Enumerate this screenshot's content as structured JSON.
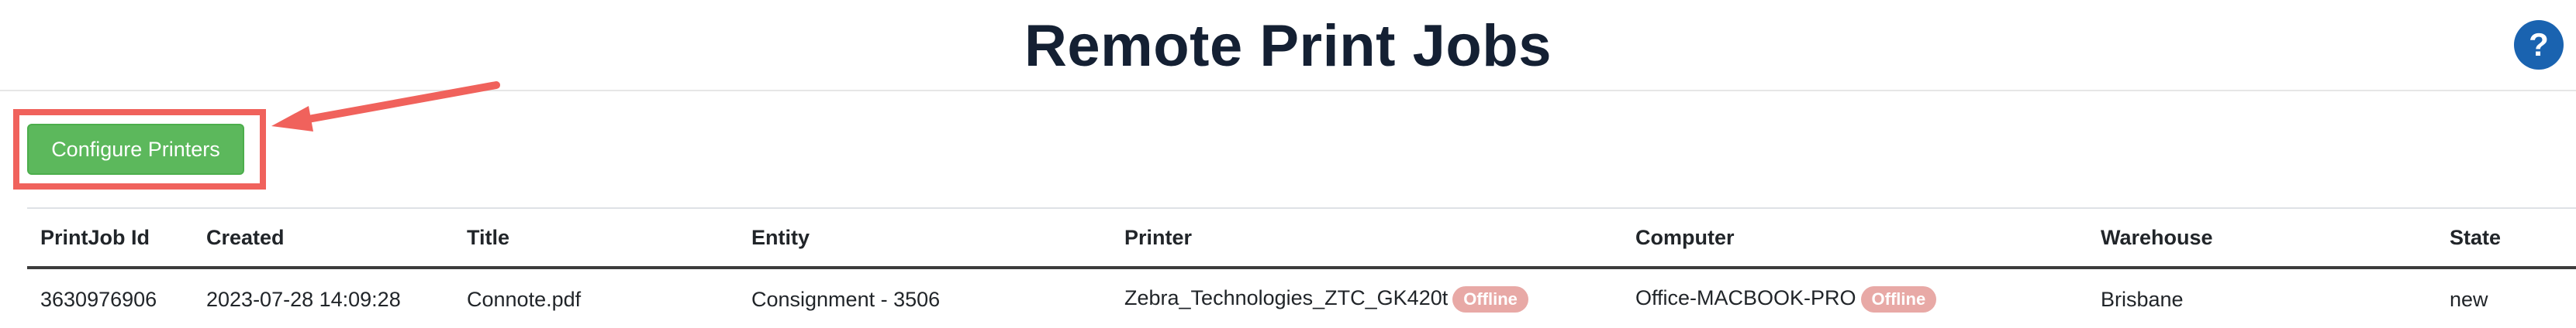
{
  "header": {
    "title": "Remote Print Jobs",
    "help_label": "?"
  },
  "toolbar": {
    "configure_printers_label": "Configure Printers"
  },
  "colors": {
    "title": "#142033",
    "help_button": "#1a63b0",
    "primary_button": "#5cb85c",
    "annotation": "#f0625c",
    "offline_badge": "#e8a9a6"
  },
  "table": {
    "columns": [
      "PrintJob Id",
      "Created",
      "Title",
      "Entity",
      "Printer",
      "Computer",
      "Warehouse",
      "State"
    ],
    "rows": [
      {
        "printjob_id": "3630976906",
        "created": "2023-07-28 14:09:28",
        "title": "Connote.pdf",
        "entity": "Consignment - 3506",
        "printer": "Zebra_Technologies_ZTC_GK420t",
        "printer_status": "Offline",
        "computer": "Office-MACBOOK-PRO",
        "computer_status": "Offline",
        "warehouse": "Brisbane",
        "state": "new"
      }
    ]
  }
}
